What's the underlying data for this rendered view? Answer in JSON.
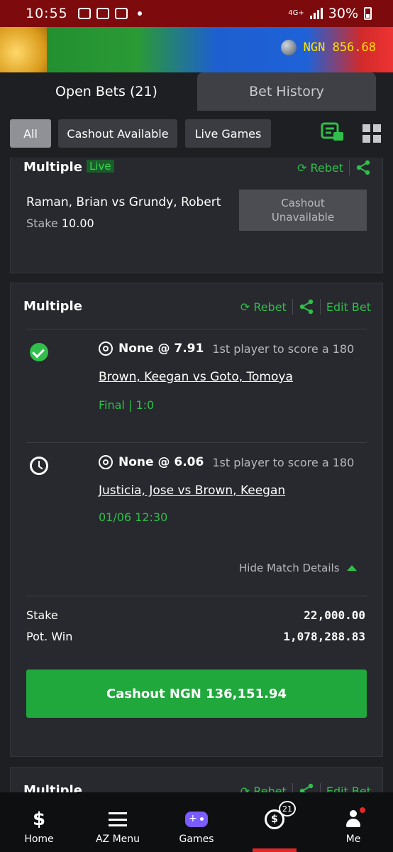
{
  "status_bar": {
    "time": "10:55",
    "network": "4G+",
    "battery": "30%"
  },
  "header": {
    "currency_balance": "NGN 856.68"
  },
  "tabs": [
    {
      "label": "Open Bets (21)",
      "active": true
    },
    {
      "label": "Bet History",
      "active": false
    }
  ],
  "filters": [
    {
      "label": "All",
      "active": true
    },
    {
      "label": "Cashout Available",
      "active": false
    },
    {
      "label": "Live Games",
      "active": false
    }
  ],
  "bets": [
    {
      "type": "Multiple",
      "live_badge": "Live",
      "actions": {
        "rebet": "Rebet"
      },
      "teams": "Raman, Brian vs Grundy, Robert",
      "stake_label": "Stake",
      "stake_value": "10.00",
      "cashout_line1": "Cashout",
      "cashout_line2": "Unavailable"
    },
    {
      "type": "Multiple",
      "actions": {
        "rebet": "Rebet",
        "edit": "Edit Bet"
      },
      "legs": [
        {
          "status_icon": "check-circle-icon",
          "selection": "None @ 7.91",
          "market": "1st player to score a 180",
          "match": "Brown, Keegan vs Goto, Tomoya",
          "status": "Final | 1:0"
        },
        {
          "status_icon": "clock-icon",
          "selection": "None @ 6.06",
          "market": "1st player to score a 180",
          "match": "Justicia, Jose vs Brown, Keegan",
          "status": "01/06 12:30"
        }
      ],
      "hide_details": "Hide Match Details",
      "stake_label": "Stake",
      "stake_value": "22,000.00",
      "potwin_label": "Pot. Win",
      "potwin_value": "1,078,288.83",
      "cashout_button": "Cashout NGN 136,151.94"
    },
    {
      "type": "Multiple",
      "actions": {
        "rebet": "Rebet",
        "edit": "Edit Bet"
      }
    }
  ],
  "bottom_nav": [
    {
      "label": "Home",
      "icon": "sporty-s-icon"
    },
    {
      "label": "AZ Menu",
      "icon": "menu-icon"
    },
    {
      "label": "Games",
      "icon": "gamepad-icon"
    },
    {
      "label": "",
      "icon": "open-bets-icon",
      "badge": "21",
      "active": true
    },
    {
      "label": "Me",
      "icon": "person-icon"
    }
  ],
  "colors": {
    "accent_green": "#2fbf4a",
    "balance_yellow": "#ffe400",
    "status_bar": "#7d0b0e"
  }
}
